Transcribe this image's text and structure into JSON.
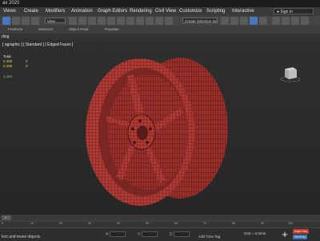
{
  "app": {
    "title": "ax 2020"
  },
  "menus": [
    "Views",
    "Create",
    "Modifiers",
    "Animation",
    "Graph Editors",
    "Rendering",
    "Civil View",
    "Customize",
    "Scripting",
    "Interactive"
  ],
  "sign_in": "Sign In",
  "toolbar": {
    "view_select": "View",
    "selection_set": "Create Selection Se"
  },
  "ribbon": {
    "groups": [
      "Freeform",
      "Selection",
      "Object Paint",
      "Populate"
    ]
  },
  "mode_row": {
    "label": "ding"
  },
  "viewport": {
    "label": "[ ographic ] [ Standard ] [ Edged Faces ]",
    "stats": {
      "title": "Total",
      "polys_value": "0 280",
      "polys_sel": "0",
      "verts_value": "0 280",
      "verts_sel": "0",
      "fps": "4,164"
    },
    "viewcube_label": "FRONT"
  },
  "timeline": {
    "slider": "0 / 100",
    "ticks": [
      "0",
      "10",
      "20",
      "30",
      "40",
      "50",
      "60",
      "70",
      "80",
      "90",
      "100"
    ]
  },
  "statusbar": {
    "hint": "lect and move objects",
    "x_label": "X:",
    "y_label": "Y:",
    "z_label": "Z:",
    "grid": "Grid = 0,0mm",
    "add_time_tag": "Add Time Tag",
    "auto_key": "Auto Key",
    "set_key": "Set Key",
    "selected": "Selected",
    "key_filters": "Key Filters..."
  },
  "colors": {
    "accent": "#4a78c0",
    "mesh_fill": "#b03a34",
    "mesh_wire": "#3a0e0c",
    "stat_yellow": "#e6d23a",
    "stat_green": "#6ad06a",
    "auto_key_red": "#c0392b"
  }
}
